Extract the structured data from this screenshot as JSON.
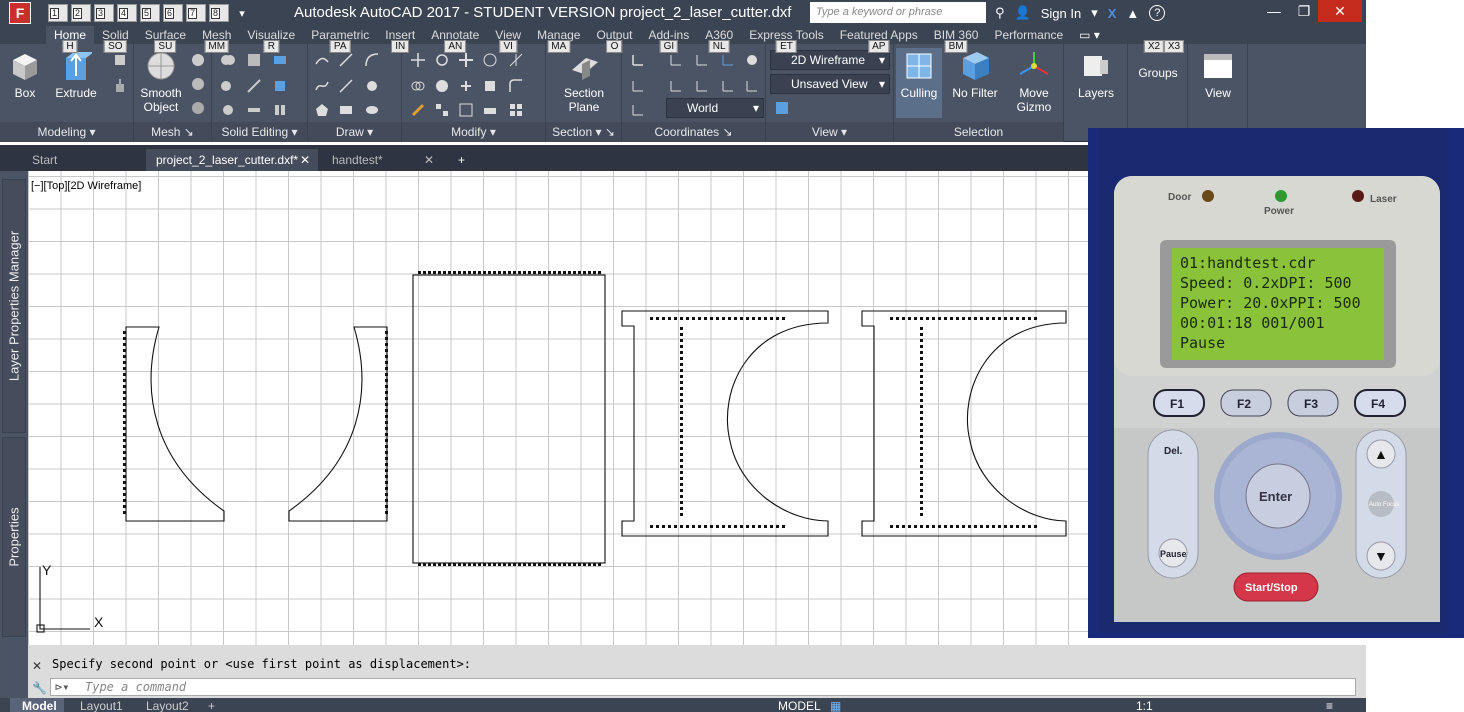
{
  "app": {
    "title": "Autodesk AutoCAD 2017 - STUDENT VERSION    project_2_laser_cutter.dxf",
    "logo_letter": "F",
    "search_placeholder": "Type a keyword or phrase",
    "sign_in": "Sign In",
    "help": "?"
  },
  "qat": [
    {
      "num": "1"
    },
    {
      "num": "2"
    },
    {
      "num": "3"
    },
    {
      "num": "4"
    },
    {
      "num": "5"
    },
    {
      "num": "6"
    },
    {
      "num": "7"
    },
    {
      "num": "8"
    }
  ],
  "ribbon_tabs": [
    {
      "label": "Home",
      "key": "H"
    },
    {
      "label": "Solid",
      "key": "SO"
    },
    {
      "label": "Surface",
      "key": "SU"
    },
    {
      "label": "Mesh",
      "key": "MM"
    },
    {
      "label": "Visualize",
      "key": "R"
    },
    {
      "label": "Parametric",
      "key": "PA"
    },
    {
      "label": "Insert",
      "key": "IN"
    },
    {
      "label": "Annotate",
      "key": "AN"
    },
    {
      "label": "View",
      "key": "VI"
    },
    {
      "label": "Manage",
      "key": "MA"
    },
    {
      "label": "Output",
      "key": "O"
    },
    {
      "label": "Add-ins",
      "key": "GI"
    },
    {
      "label": "A360",
      "key": "NL"
    },
    {
      "label": "Express Tools",
      "key": "ET"
    },
    {
      "label": "Featured Apps",
      "key": "AP"
    },
    {
      "label": "BIM 360",
      "key": "BM"
    },
    {
      "label": "Performance",
      "key": ""
    }
  ],
  "ribbon": {
    "box": "Box",
    "extrude": "Extrude",
    "smooth_object": "Smooth\nObject",
    "section_plane": "Section\nPlane",
    "culling": "Culling",
    "no_filter": "No Filter",
    "move_gizmo": "Move\nGizmo",
    "layers": "Layers",
    "groups": "Groups",
    "view": "View",
    "visual_style": "2D Wireframe",
    "named_view": "Unsaved View",
    "ucs": "World",
    "panels": {
      "modeling": "Modeling",
      "mesh": "Mesh",
      "solid_editing": "Solid Editing",
      "draw": "Draw",
      "modify": "Modify",
      "section": "Section",
      "coordinates": "Coordinates",
      "view": "View",
      "selection": "Selection"
    },
    "keytips_extra": [
      "X2",
      "X3"
    ]
  },
  "doc_tabs": [
    {
      "label": "Start"
    },
    {
      "label": "project_2_laser_cutter.dxf*"
    },
    {
      "label": "handtest*"
    }
  ],
  "palettes": {
    "layer_props": "Layer Properties Manager",
    "properties": "Properties"
  },
  "viewport_label": "[−][Top][2D Wireframe]",
  "ucs_axes": {
    "y": "Y",
    "x": "X"
  },
  "controller": {
    "leds": [
      "Door",
      "Power",
      "Laser"
    ],
    "lcd": [
      "01:handtest.cdr",
      "Speed:  0.2xDPI: 500",
      "Power: 20.0xPPI: 500",
      "00:01:18     001/001",
      "Pause"
    ],
    "fkeys": [
      "F1",
      "F2",
      "F3",
      "F4"
    ],
    "del": "Del.",
    "pause": "Pause",
    "enter": "Enter",
    "auto_focus": "Auto\nFocus",
    "start_stop": "Start/Stop"
  },
  "command": {
    "history": "Specify second point or <use first point as displacement>:",
    "placeholder": "Type a command"
  },
  "status": {
    "model": "Model",
    "layout1": "Layout1",
    "layout2": "Layout2",
    "model_space": "MODEL",
    "scale": "1:1"
  }
}
